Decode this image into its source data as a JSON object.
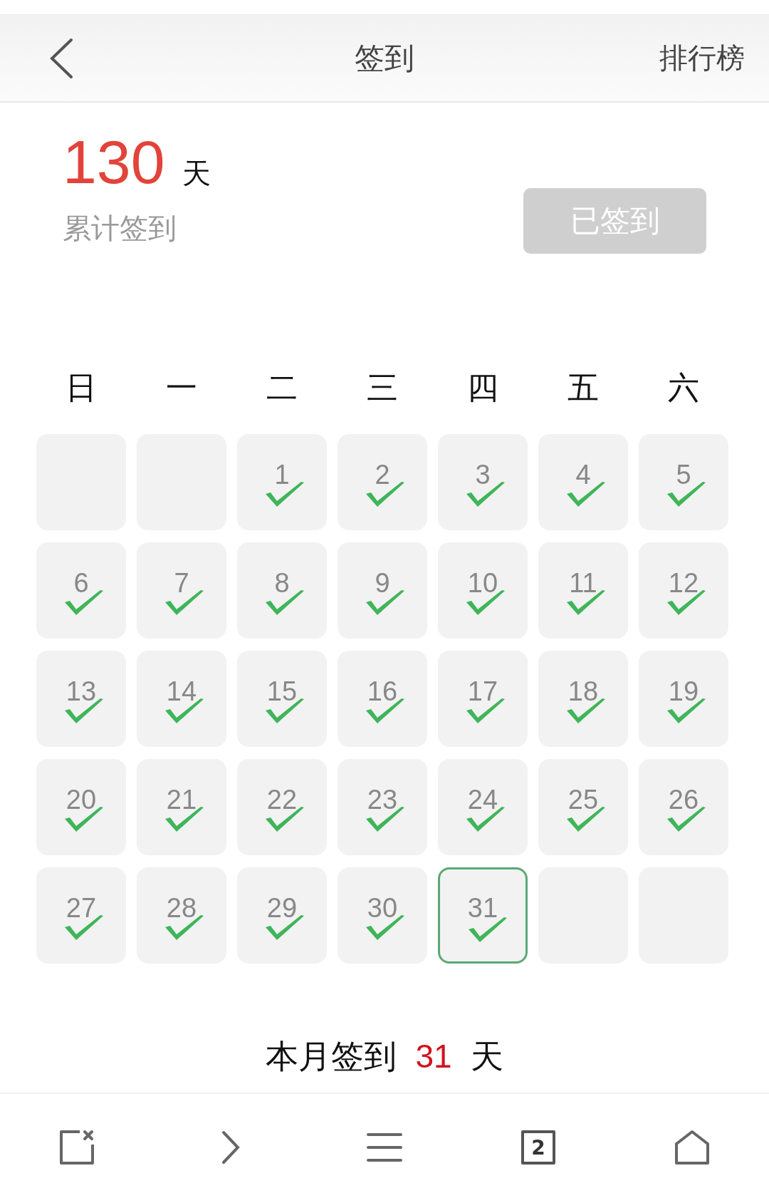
{
  "header": {
    "title": "签到",
    "action": "排行榜"
  },
  "total": {
    "count": "130",
    "unit": "天",
    "label": "累计签到"
  },
  "sign_button": {
    "label": "已签到",
    "disabled": true
  },
  "weekdays": [
    "日",
    "一",
    "二",
    "三",
    "四",
    "五",
    "六"
  ],
  "days": [
    {
      "kind": "empty"
    },
    {
      "kind": "empty"
    },
    {
      "kind": "day",
      "day": "1",
      "checked": true,
      "selected": false
    },
    {
      "kind": "day",
      "day": "2",
      "checked": true,
      "selected": false
    },
    {
      "kind": "day",
      "day": "3",
      "checked": true,
      "selected": false
    },
    {
      "kind": "day",
      "day": "4",
      "checked": true,
      "selected": false
    },
    {
      "kind": "day",
      "day": "5",
      "checked": true,
      "selected": false
    },
    {
      "kind": "day",
      "day": "6",
      "checked": true,
      "selected": false
    },
    {
      "kind": "day",
      "day": "7",
      "checked": true,
      "selected": false
    },
    {
      "kind": "day",
      "day": "8",
      "checked": true,
      "selected": false
    },
    {
      "kind": "day",
      "day": "9",
      "checked": true,
      "selected": false
    },
    {
      "kind": "day",
      "day": "10",
      "checked": true,
      "selected": false
    },
    {
      "kind": "day",
      "day": "11",
      "checked": true,
      "selected": false
    },
    {
      "kind": "day",
      "day": "12",
      "checked": true,
      "selected": false
    },
    {
      "kind": "day",
      "day": "13",
      "checked": true,
      "selected": false
    },
    {
      "kind": "day",
      "day": "14",
      "checked": true,
      "selected": false
    },
    {
      "kind": "day",
      "day": "15",
      "checked": true,
      "selected": false
    },
    {
      "kind": "day",
      "day": "16",
      "checked": true,
      "selected": false
    },
    {
      "kind": "day",
      "day": "17",
      "checked": true,
      "selected": false
    },
    {
      "kind": "day",
      "day": "18",
      "checked": true,
      "selected": false
    },
    {
      "kind": "day",
      "day": "19",
      "checked": true,
      "selected": false
    },
    {
      "kind": "day",
      "day": "20",
      "checked": true,
      "selected": false
    },
    {
      "kind": "day",
      "day": "21",
      "checked": true,
      "selected": false
    },
    {
      "kind": "day",
      "day": "22",
      "checked": true,
      "selected": false
    },
    {
      "kind": "day",
      "day": "23",
      "checked": true,
      "selected": false
    },
    {
      "kind": "day",
      "day": "24",
      "checked": true,
      "selected": false
    },
    {
      "kind": "day",
      "day": "25",
      "checked": true,
      "selected": false
    },
    {
      "kind": "day",
      "day": "26",
      "checked": true,
      "selected": false
    },
    {
      "kind": "day",
      "day": "27",
      "checked": true,
      "selected": false
    },
    {
      "kind": "day",
      "day": "28",
      "checked": true,
      "selected": false
    },
    {
      "kind": "day",
      "day": "29",
      "checked": true,
      "selected": false
    },
    {
      "kind": "day",
      "day": "30",
      "checked": true,
      "selected": false
    },
    {
      "kind": "day",
      "day": "31",
      "checked": true,
      "selected": true
    },
    {
      "kind": "empty"
    },
    {
      "kind": "empty"
    }
  ],
  "month_summary": {
    "prefix": "本月签到",
    "count": "31",
    "unit": "天"
  },
  "bottom_bar": {
    "tab_count": "2"
  }
}
